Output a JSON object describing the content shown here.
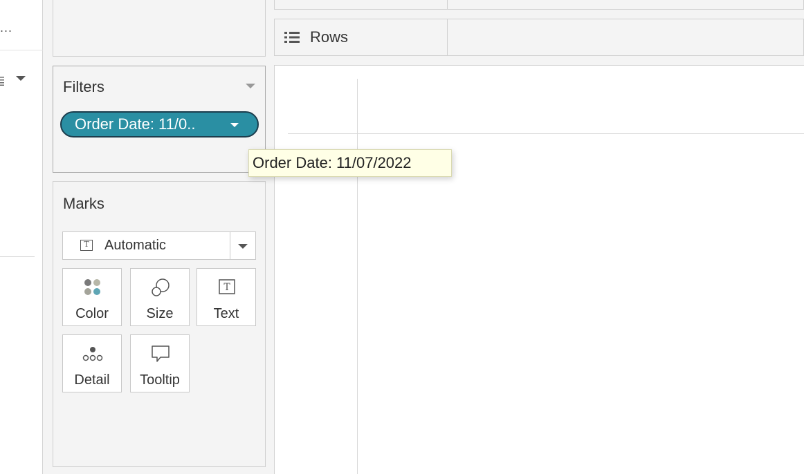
{
  "left_pane": {
    "ellipsis": "..."
  },
  "filters": {
    "title": "Filters",
    "pill_label": "Order Date: 11/0.."
  },
  "tooltip": {
    "text": "Order Date: 11/07/2022"
  },
  "marks": {
    "title": "Marks",
    "mark_type": "Automatic",
    "buttons": {
      "color": "Color",
      "size": "Size",
      "text": "Text",
      "detail": "Detail",
      "tooltip": "Tooltip"
    }
  },
  "shelves": {
    "rows_label": "Rows"
  },
  "colors": {
    "pill_fill": "#2a8fa3",
    "pill_border": "#1c3d4d",
    "tooltip_bg": "#ffffe6",
    "panel_bg": "#f4f4f4"
  },
  "icons": [
    "list-icon",
    "caret-down-icon",
    "text-mark-icon",
    "color-dots-icon",
    "size-circles-icon",
    "detail-dots-icon",
    "speech-bubble-icon"
  ]
}
